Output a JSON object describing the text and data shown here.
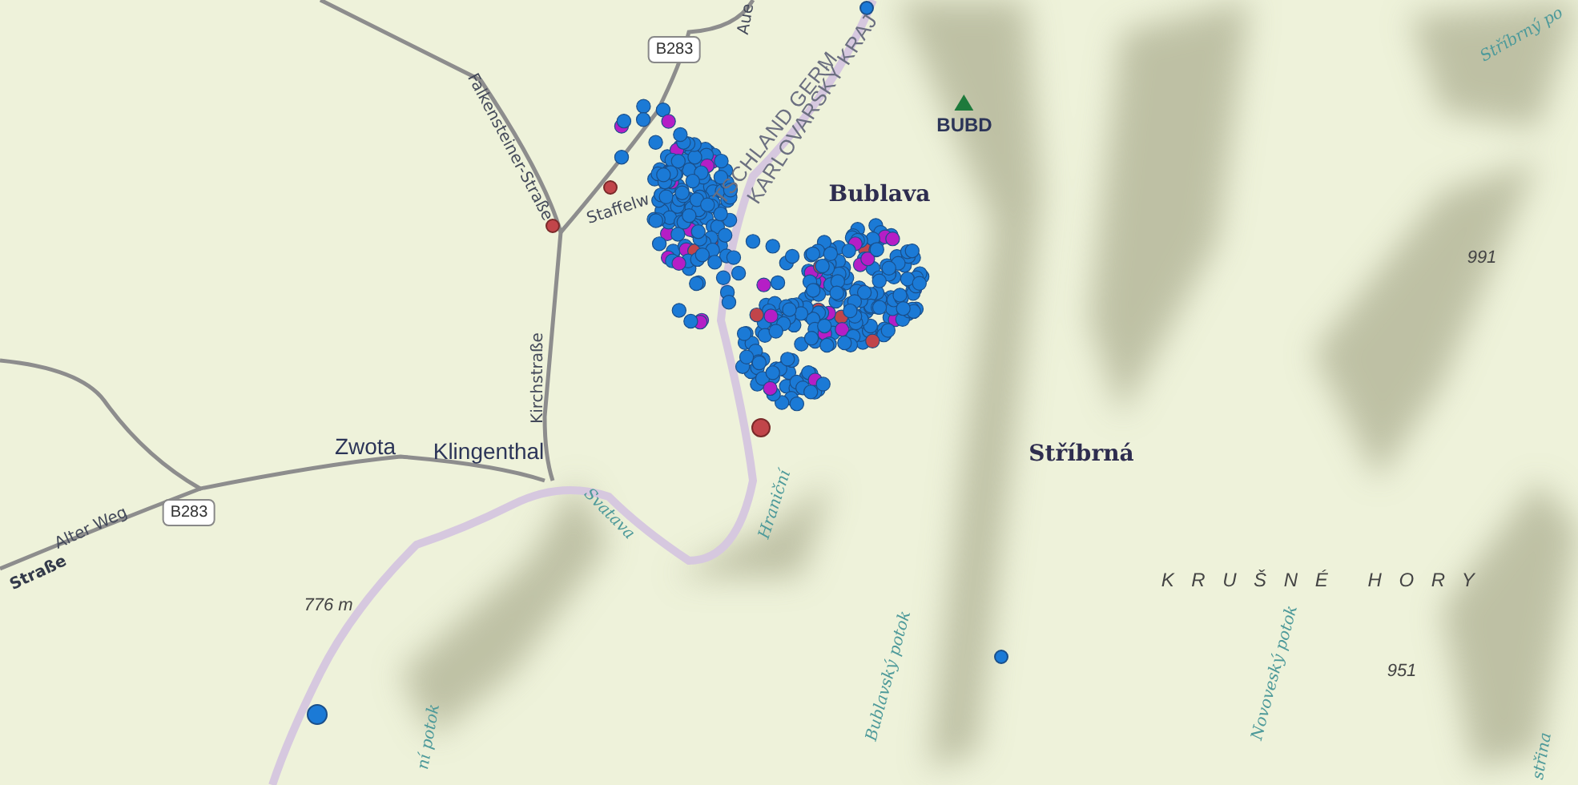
{
  "map": {
    "labels": [
      {
        "text": "Aue",
        "kind": "road"
      },
      {
        "text": "Stříbrný po",
        "kind": "water"
      },
      {
        "text": "B283",
        "kind": "shield"
      },
      {
        "text": "Falkensteiner-Straße",
        "kind": "road"
      },
      {
        "text": "TSCHLAND GERM",
        "kind": "border"
      },
      {
        "text": "KARLOVARSKÝ KRAJ",
        "kind": "border"
      },
      {
        "text": "Staffelw",
        "kind": "road"
      },
      {
        "text": "Bublava",
        "kind": "village"
      },
      {
        "text": "BUBD",
        "kind": "station"
      },
      {
        "text": "991",
        "kind": "peak"
      },
      {
        "text": "Kirchstraße",
        "kind": "road"
      },
      {
        "text": "Zwota",
        "kind": "town"
      },
      {
        "text": "Klingenthal",
        "kind": "town"
      },
      {
        "text": "Stříbrná",
        "kind": "village"
      },
      {
        "text": "B283",
        "kind": "shield"
      },
      {
        "text": "Alter Weg",
        "kind": "road"
      },
      {
        "text": "Straße",
        "kind": "street"
      },
      {
        "text": "776 m",
        "kind": "peak"
      },
      {
        "text": "Svatava",
        "kind": "water"
      },
      {
        "text": "Hraniční",
        "kind": "water"
      },
      {
        "text": "KRUŠNÉ HORY",
        "kind": "region"
      },
      {
        "text": "Bublavský potok",
        "kind": "water"
      },
      {
        "text": "Novoveský potok",
        "kind": "water"
      },
      {
        "text": "951",
        "kind": "peak"
      },
      {
        "text": "ní potok",
        "kind": "water"
      },
      {
        "text": "střina",
        "kind": "water"
      }
    ]
  }
}
